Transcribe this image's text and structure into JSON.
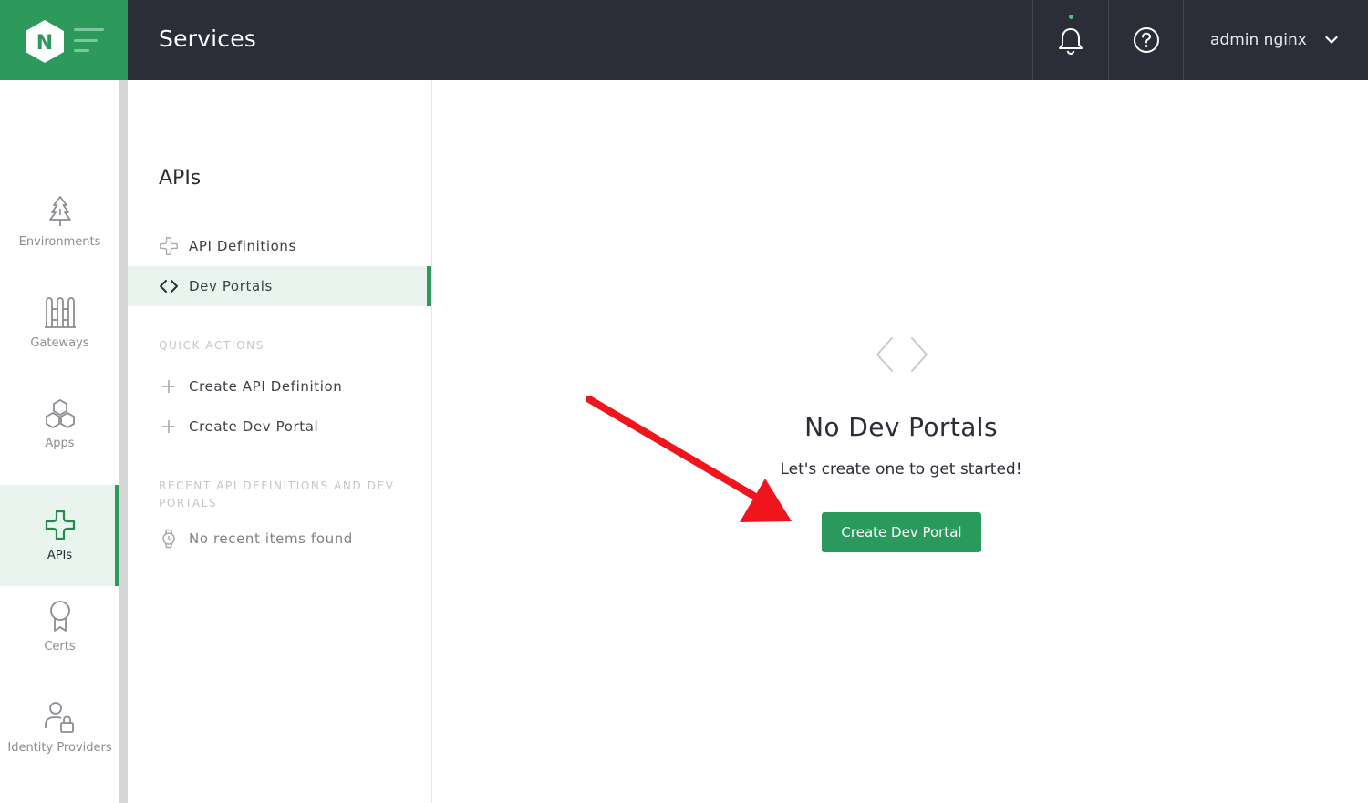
{
  "header": {
    "logo_letter": "N",
    "title": "Services",
    "user_name": "admin nginx",
    "notification_icon": "bell-icon",
    "help_icon": "help-circle-icon",
    "user_menu_icon": "chevron-down-icon"
  },
  "leftnav": {
    "items": [
      {
        "label": "Environments",
        "icon": "tree-icon",
        "active": false
      },
      {
        "label": "Gateways",
        "icon": "gateway-icon",
        "active": false
      },
      {
        "label": "Apps",
        "icon": "hexagons-icon",
        "active": false
      },
      {
        "label": "APIs",
        "icon": "api-plus-icon",
        "active": true
      },
      {
        "label": "Certs",
        "icon": "ribbon-icon",
        "active": false
      },
      {
        "label": "Identity Providers",
        "icon": "user-lock-icon",
        "active": false
      }
    ]
  },
  "subnav": {
    "title": "APIs",
    "items": [
      {
        "label": "API Definitions",
        "icon": "api-plus-icon",
        "active": false
      },
      {
        "label": "Dev Portals",
        "icon": "code-brackets-icon",
        "active": true
      }
    ],
    "quick_actions_label": "QUICK ACTIONS",
    "quick_actions": [
      {
        "label": "Create API Definition",
        "icon": "plus-icon"
      },
      {
        "label": "Create Dev Portal",
        "icon": "plus-icon"
      }
    ],
    "recent_label": "RECENT API DEFINITIONS AND DEV PORTALS",
    "recent_empty": "No recent items found",
    "recent_icon": "watch-icon"
  },
  "main": {
    "empty_icon": "code-brackets-icon",
    "empty_title": "No Dev Portals",
    "empty_subtitle": "Let's create one to get started!",
    "cta_label": "Create Dev Portal"
  },
  "colors": {
    "brand_green": "#2d9a5c",
    "topbar": "#2b2e38",
    "active_bg": "#e9f4ee",
    "annotation_arrow": "#f0141c"
  }
}
